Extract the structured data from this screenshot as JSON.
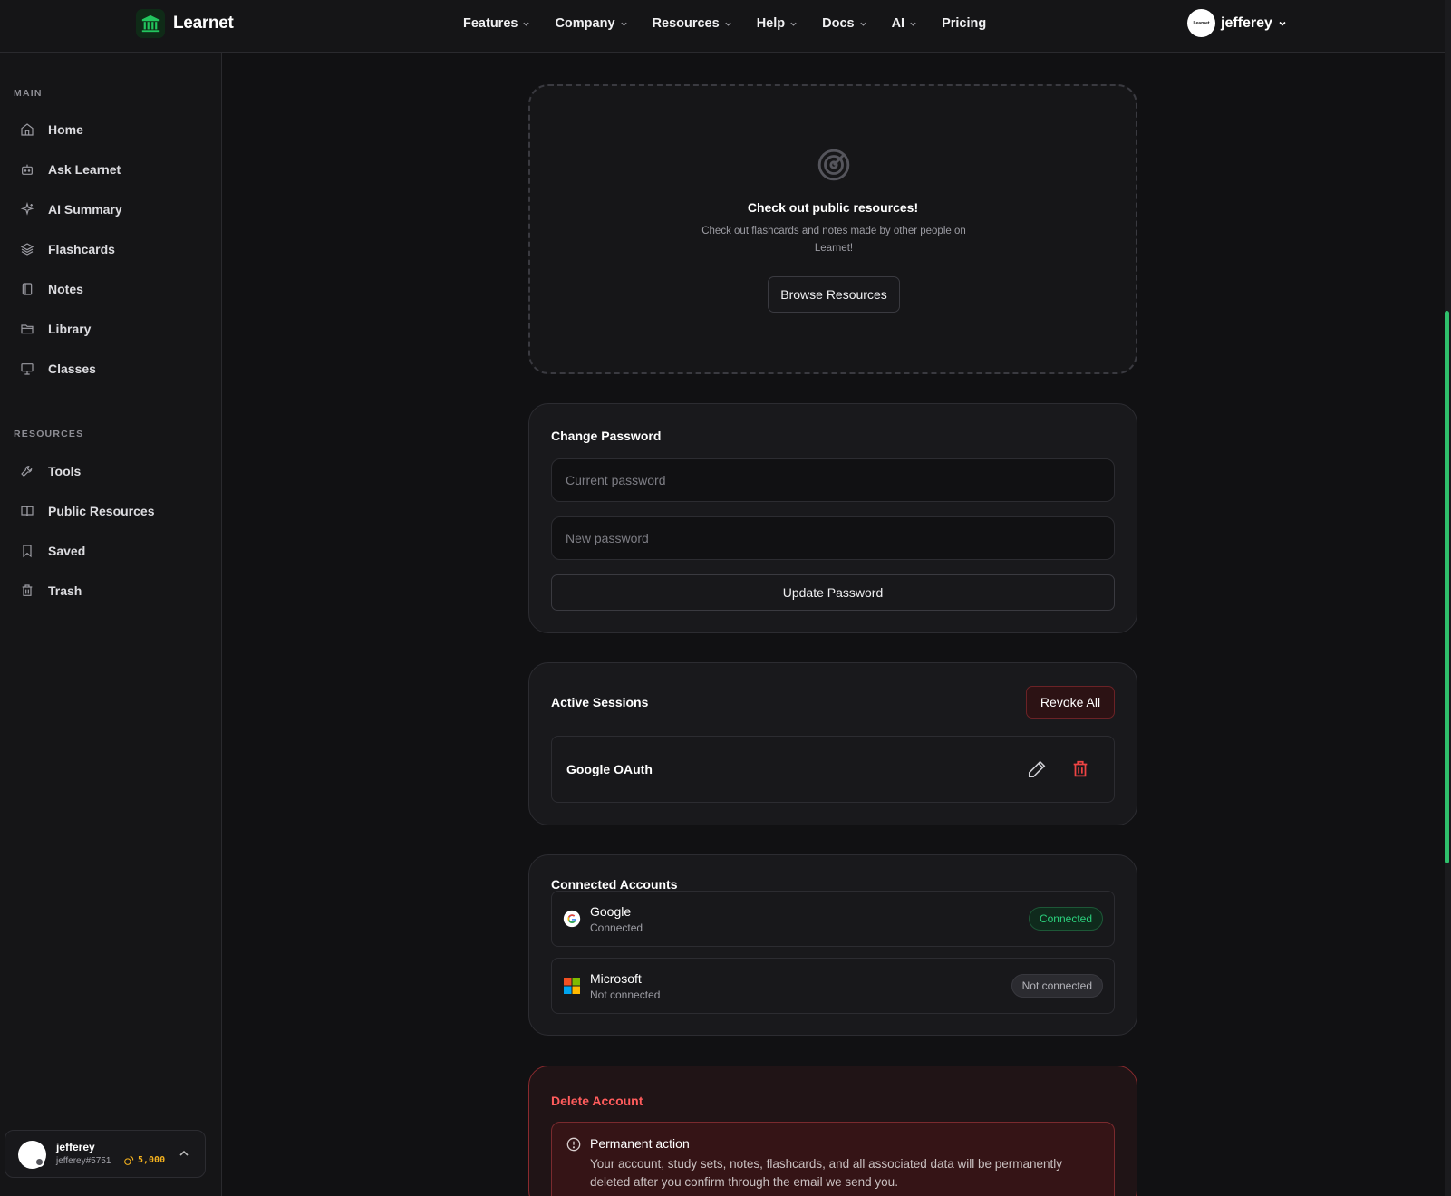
{
  "brand": {
    "name": "Learnet",
    "accent": "#22c55e"
  },
  "nav": {
    "items": [
      {
        "label": "Features",
        "has_menu": true
      },
      {
        "label": "Company",
        "has_menu": true
      },
      {
        "label": "Resources",
        "has_menu": true
      },
      {
        "label": "Help",
        "has_menu": true
      },
      {
        "label": "Docs",
        "has_menu": true
      },
      {
        "label": "AI",
        "has_menu": true
      },
      {
        "label": "Pricing",
        "has_menu": false
      }
    ],
    "user": {
      "name": "jefferey",
      "avatar_text": "Learnet"
    }
  },
  "sidebar": {
    "main_heading": "MAIN",
    "main_items": [
      {
        "label": "Home",
        "icon": "home-icon"
      },
      {
        "label": "Ask Learnet",
        "icon": "bot-icon"
      },
      {
        "label": "AI Summary",
        "icon": "sparkles-icon"
      },
      {
        "label": "Flashcards",
        "icon": "layers-icon"
      },
      {
        "label": "Notes",
        "icon": "notebook-icon"
      },
      {
        "label": "Library",
        "icon": "folder-icon"
      },
      {
        "label": "Classes",
        "icon": "presentation-icon"
      }
    ],
    "resources_heading": "RESOURCES",
    "resource_items": [
      {
        "label": "Tools",
        "icon": "wrench-icon"
      },
      {
        "label": "Public Resources",
        "icon": "book-open-icon"
      },
      {
        "label": "Saved",
        "icon": "bookmark-icon"
      },
      {
        "label": "Trash",
        "icon": "trash-icon"
      }
    ],
    "profile": {
      "name": "jefferey",
      "handle": "jefferey#5751",
      "coins": "5,000"
    }
  },
  "public_resources": {
    "title": "Check out public resources!",
    "description": "Check out flashcards and notes made by other people on Learnet!",
    "button": "Browse Resources"
  },
  "change_password": {
    "title": "Change Password",
    "current_placeholder": "Current password",
    "new_placeholder": "New password",
    "button": "Update Password"
  },
  "sessions": {
    "title": "Active Sessions",
    "revoke_all": "Revoke All",
    "items": [
      {
        "name": "Google OAuth"
      }
    ]
  },
  "connected_accounts": {
    "title": "Connected Accounts",
    "items": [
      {
        "name": "Google",
        "status": "Connected",
        "badge": "Connected",
        "connected": true
      },
      {
        "name": "Microsoft",
        "status": "Not connected",
        "badge": "Not connected",
        "connected": false
      }
    ]
  },
  "delete_account": {
    "title": "Delete Account",
    "notice_title": "Permanent action",
    "notice_text": "Your account, study sets, notes, flashcards, and all associated data will be permanently deleted after you confirm through the email we send you."
  }
}
